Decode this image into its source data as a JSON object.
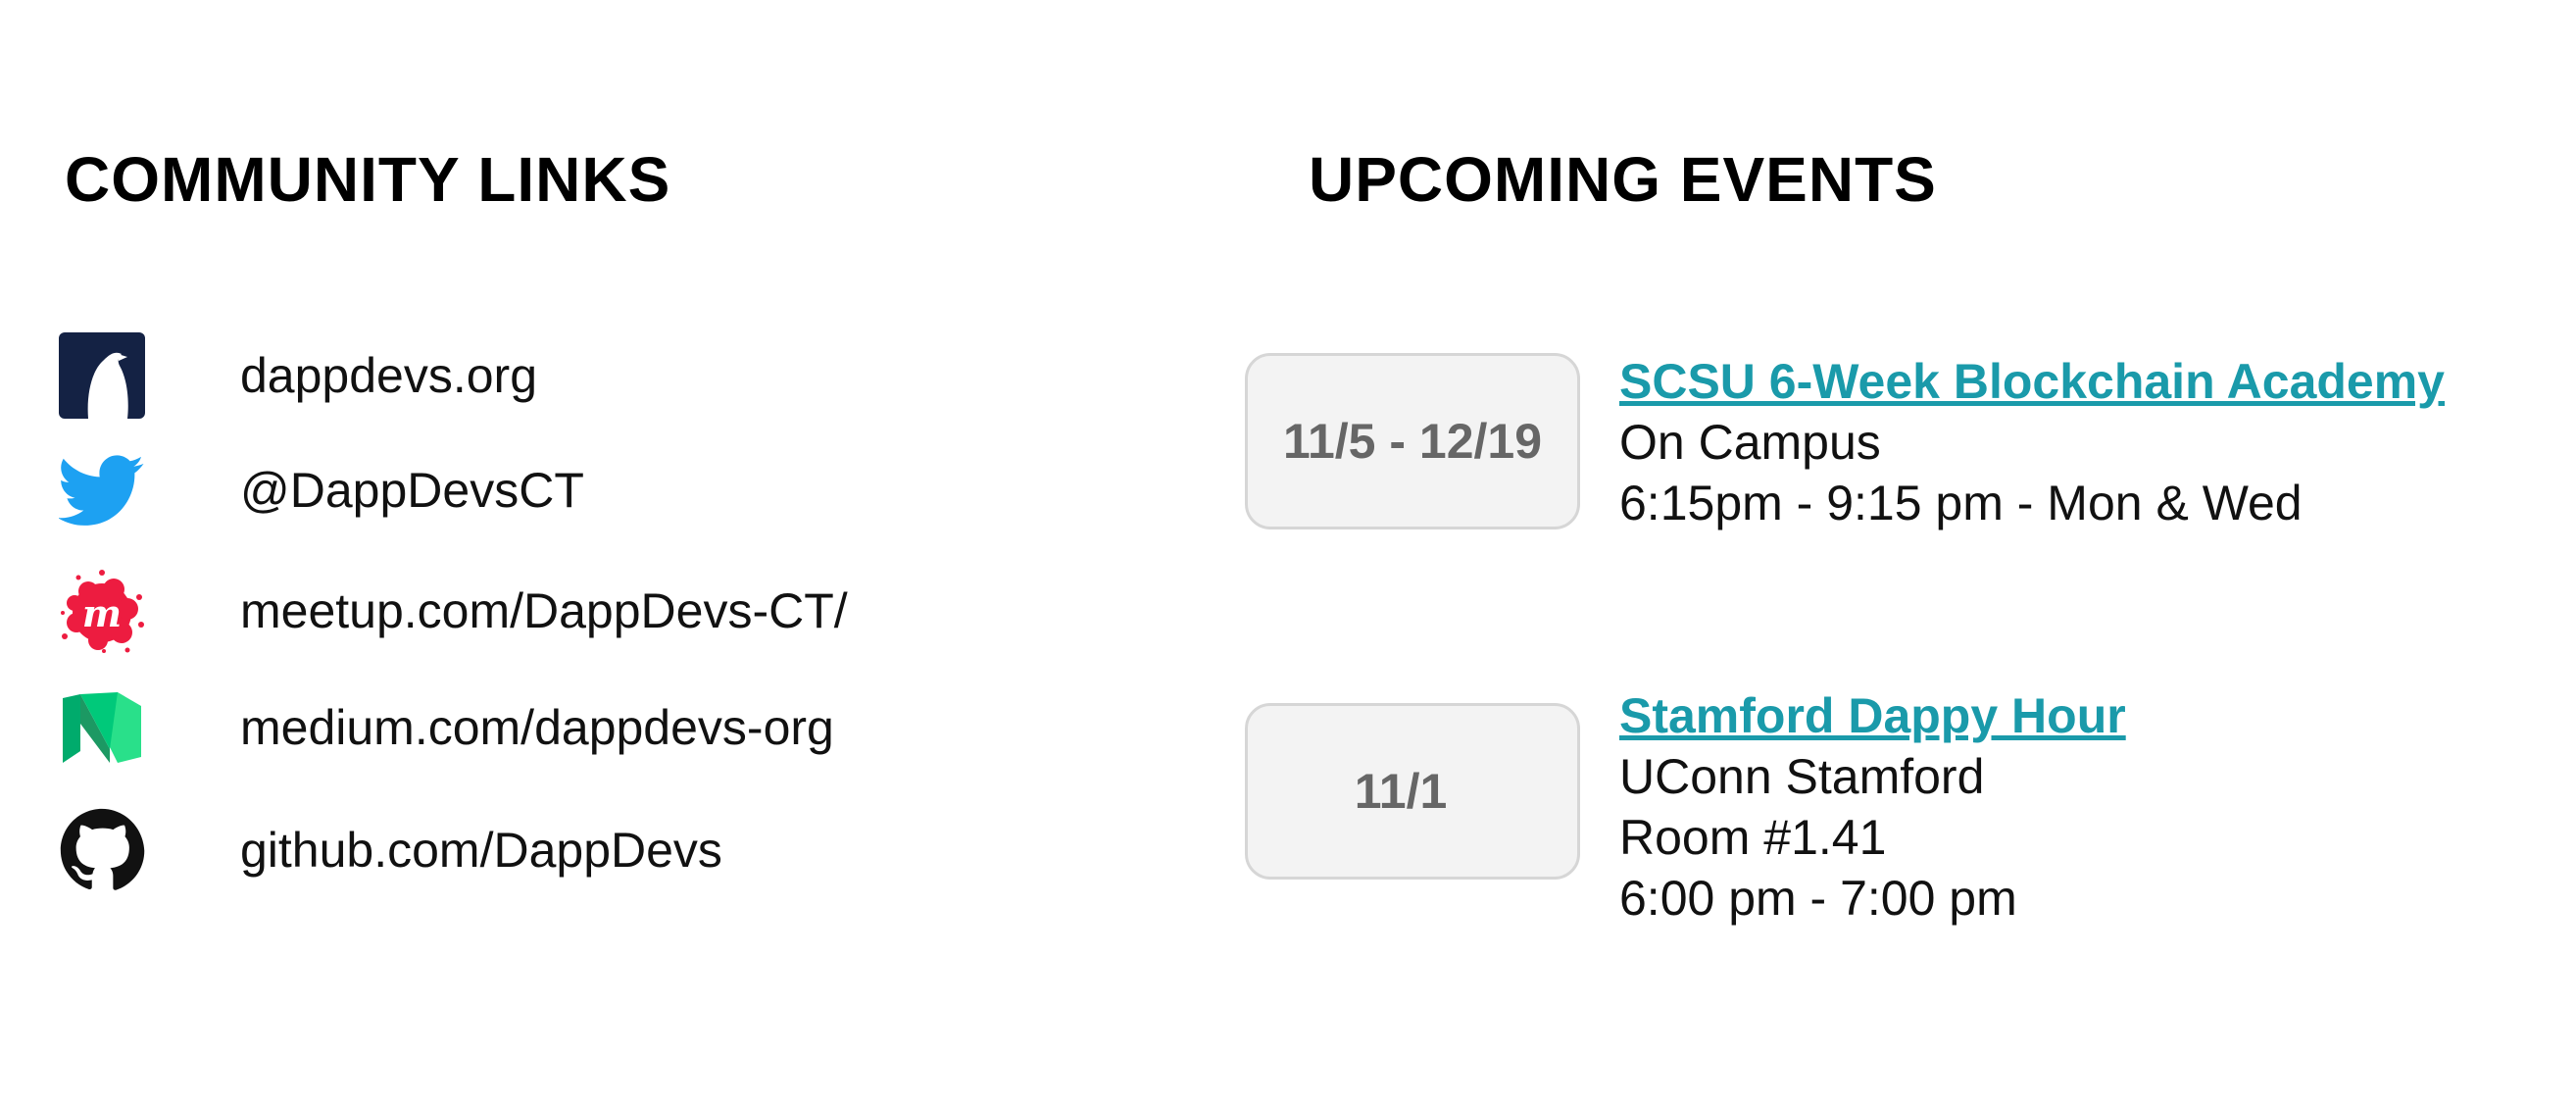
{
  "community": {
    "heading": "COMMUNITY LINKS",
    "links": [
      {
        "icon": "dappdevs-penguin-icon",
        "text": "dappdevs.org"
      },
      {
        "icon": "twitter-icon",
        "text": "@DappDevsCT"
      },
      {
        "icon": "meetup-icon",
        "text": "meetup.com/DappDevs-CT/"
      },
      {
        "icon": "medium-icon",
        "text": "medium.com/dappdevs-org"
      },
      {
        "icon": "github-icon",
        "text": "github.com/DappDevs"
      }
    ]
  },
  "events": {
    "heading": "UPCOMING EVENTS",
    "items": [
      {
        "date": "11/5 - 12/19",
        "title": "SCSU 6-Week Blockchain Academy",
        "lines": [
          "On Campus",
          "6:15pm - 9:15 pm - Mon & Wed"
        ]
      },
      {
        "date": "11/1",
        "title": "Stamford Dappy Hour",
        "lines": [
          "UConn Stamford",
          "Room #1.41",
          "6:00 pm - 7:00 pm"
        ]
      }
    ]
  },
  "colors": {
    "link_accent": "#1a9aaa",
    "date_box_bg": "#f3f3f3",
    "date_box_border": "#d6d6d6",
    "dappdevs_navy": "#142244",
    "twitter_blue": "#1da1f2",
    "meetup_red": "#ed1c40",
    "medium_green": "#00ab6c"
  }
}
